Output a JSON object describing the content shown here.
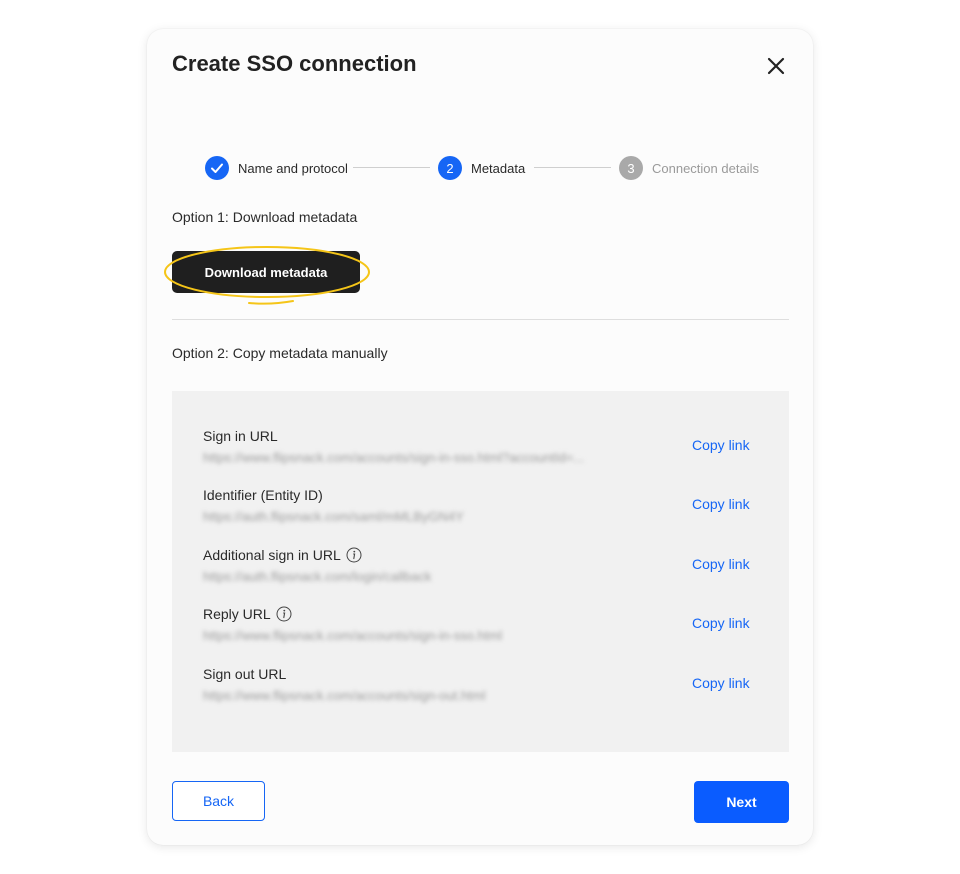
{
  "dialog": {
    "title": "Create SSO connection",
    "close_icon": "close-icon"
  },
  "stepper": {
    "steps": [
      {
        "number": "1",
        "label": "Name and protocol",
        "state": "completed",
        "icon": "check-icon"
      },
      {
        "number": "2",
        "label": "Metadata",
        "state": "active"
      },
      {
        "number": "3",
        "label": "Connection details",
        "state": "upcoming"
      }
    ]
  },
  "option1": {
    "title": "Option 1: Download metadata",
    "button_label": "Download metadata"
  },
  "option2": {
    "title": "Option 2: Copy metadata manually",
    "rows": [
      {
        "label": "Sign in URL",
        "value": "https://www.flipsnack.com/accounts/sign-in-sso.html?accountId=...",
        "info": false,
        "action": "Copy link"
      },
      {
        "label": "Identifier (Entity ID)",
        "value": "https://auth.flipsnack.com/saml/mMLByGN4Y",
        "info": false,
        "action": "Copy link"
      },
      {
        "label": "Additional sign in URL",
        "value": "https://auth.flipsnack.com/login/callback",
        "info": true,
        "action": "Copy link"
      },
      {
        "label": "Reply URL",
        "value": "https://www.flipsnack.com/accounts/sign-in-sso.html",
        "info": true,
        "action": "Copy link"
      },
      {
        "label": "Sign out URL",
        "value": "https://www.flipsnack.com/accounts/sign-out.html",
        "info": false,
        "action": "Copy link"
      }
    ]
  },
  "footer": {
    "back_label": "Back",
    "next_label": "Next"
  },
  "colors": {
    "accent": "#1666f5",
    "primary_button": "#0a5cff",
    "dark_button": "#1f1f1f",
    "highlight": "#f5c518",
    "panel_bg": "#f1f1f1",
    "step_inactive": "#a9a9a9"
  }
}
